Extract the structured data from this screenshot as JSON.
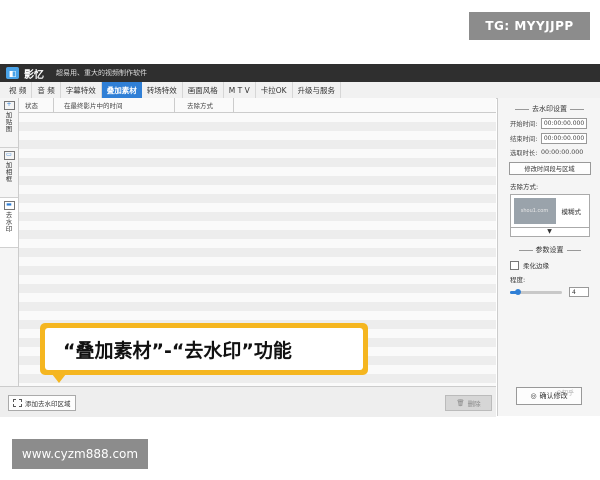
{
  "overlay": {
    "tg_text": "TG: MYYJJPP",
    "site_text": "www.cyzm888.com"
  },
  "app": {
    "name": "影忆",
    "slogan": "超易用、重大的视频制作软件",
    "tabs": [
      {
        "label": "视 频",
        "active": false
      },
      {
        "label": "音 频",
        "active": false
      },
      {
        "label": "字幕特效",
        "active": false
      },
      {
        "label": "叠加素材",
        "active": true
      },
      {
        "label": "转场特效",
        "active": false
      },
      {
        "label": "画面风格",
        "active": false
      },
      {
        "label": "M T V",
        "active": false
      },
      {
        "label": "卡拉OK",
        "active": false
      },
      {
        "label": "升级与服务",
        "active": false
      }
    ],
    "side_tabs": [
      {
        "label": "加贴图",
        "icon": "sticker-icon"
      },
      {
        "label": "加相框",
        "icon": "frame-icon"
      },
      {
        "label": "去水印",
        "icon": "watermark-icon",
        "active": true
      }
    ],
    "list": {
      "headers": [
        "状态",
        "在最终影片中的时间",
        "去除方式"
      ]
    },
    "bottom": {
      "add_label": "添加去水印区域",
      "delete_label": "删除"
    },
    "right_panel": {
      "section1_title": "去水印设置",
      "start_label": "开始时间:",
      "start_value": "00:00:00.000",
      "end_label": "结束时间:",
      "end_value": "00:00:00.000",
      "duration_label": "选取时长:",
      "duration_value": "00:00:00.000",
      "modify_button": "修改时间段与区域",
      "mode_label": "去除方式:",
      "mode_thumb_text": "shou1.com",
      "mode_value": "模糊式",
      "mode_arrow": "▼",
      "section2_title": "参数设置",
      "soften_label": "柔化边缘",
      "degree_label": "程度:",
      "degree_value": "4",
      "degree_fraction": 0.15,
      "confirm_button": "确认修改",
      "confirm_watermark": "@知乎"
    }
  },
  "callout": {
    "text": "“叠加素材”-“去水印”功能"
  },
  "colors": {
    "accent": "#2f7fd6",
    "callout_border": "#f5b620",
    "titlebar": "#2f2f2f"
  }
}
